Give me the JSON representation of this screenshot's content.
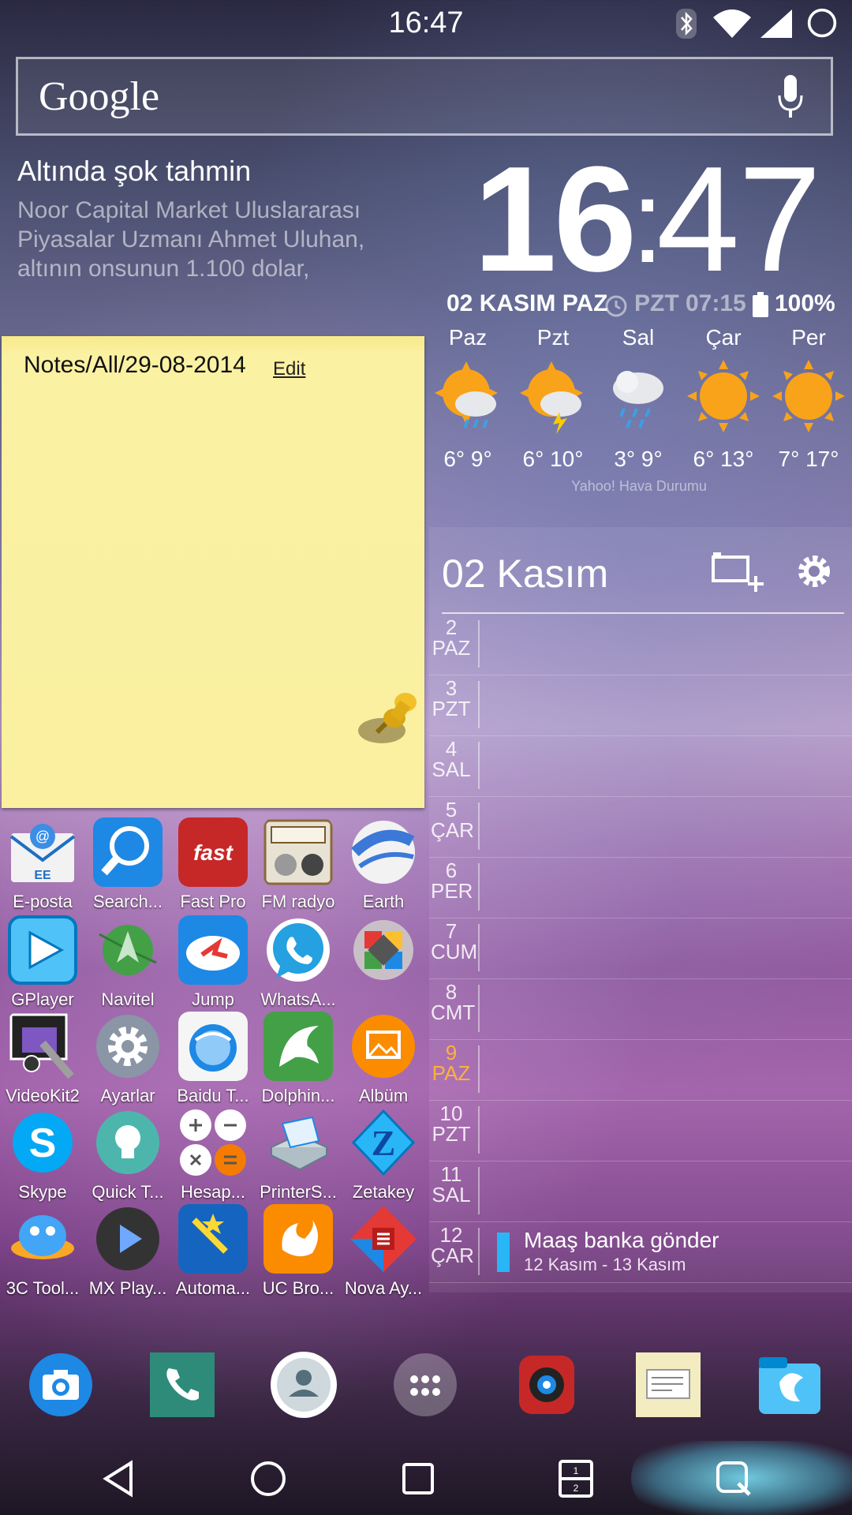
{
  "status_bar": {
    "time": "16:47"
  },
  "search": {
    "logo": "Google"
  },
  "news": {
    "title": "Altında şok tahmin",
    "text": "Noor Capital Market Uluslararası Piyasalar Uzmanı Ahmet Uluhan, altının onsunun 1.100 dolar,"
  },
  "clock": {
    "hours": "16",
    "separator": ":",
    "minutes": "47",
    "date": "02 KASIM PAZ",
    "alarm": "PZT 07:15",
    "battery": "100%"
  },
  "weather": {
    "days": [
      {
        "name": "Paz",
        "temp": "6° 9°",
        "icon": "cloud-rain-sun-icon"
      },
      {
        "name": "Pzt",
        "temp": "6° 10°",
        "icon": "thunderstorm-sun-icon"
      },
      {
        "name": "Sal",
        "temp": "3° 9°",
        "icon": "cloud-snow-rain-icon"
      },
      {
        "name": "Çar",
        "temp": "6° 13°",
        "icon": "sun-icon"
      },
      {
        "name": "Per",
        "temp": "7° 17°",
        "icon": "sun-icon"
      }
    ],
    "source": "Yahoo! Hava Durumu"
  },
  "note": {
    "title": "Notes/All/29-08-2014",
    "edit": "Edit"
  },
  "calendar": {
    "title": "02 Kasım",
    "rows": [
      {
        "num": "2",
        "dow": "PAZ"
      },
      {
        "num": "3",
        "dow": "PZT"
      },
      {
        "num": "4",
        "dow": "SAL"
      },
      {
        "num": "5",
        "dow": "ÇAR"
      },
      {
        "num": "6",
        "dow": "PER"
      },
      {
        "num": "7",
        "dow": "CUM"
      },
      {
        "num": "8",
        "dow": "CMT"
      },
      {
        "num": "9",
        "dow": "PAZ"
      },
      {
        "num": "10",
        "dow": "PZT"
      },
      {
        "num": "11",
        "dow": "SAL"
      },
      {
        "num": "12",
        "dow": "ÇAR"
      }
    ],
    "event": {
      "title": "Maaş banka gönder",
      "range": "12 Kasım - 13 Kasım"
    }
  },
  "apps": [
    [
      "E-posta",
      "Search...",
      "Fast Pro",
      "FM radyo",
      "Earth"
    ],
    [
      "GPlayer",
      "Navitel",
      "Jump",
      "WhatsA...",
      ""
    ],
    [
      "VideoKit2",
      "Ayarlar",
      "Baidu T...",
      "Dolphin...",
      "Albüm"
    ],
    [
      "Skype",
      "Quick T...",
      "Hesap...",
      "PrinterS...",
      "Zetakey"
    ],
    [
      "3C Tool...",
      "MX Play...",
      "Automa...",
      "UC Bro...",
      "Nova Ay..."
    ]
  ],
  "colors": {
    "accent_sunday": "#ffb13b",
    "event_bar": "#29b6f6",
    "note_yellow": "#faf0a0"
  }
}
